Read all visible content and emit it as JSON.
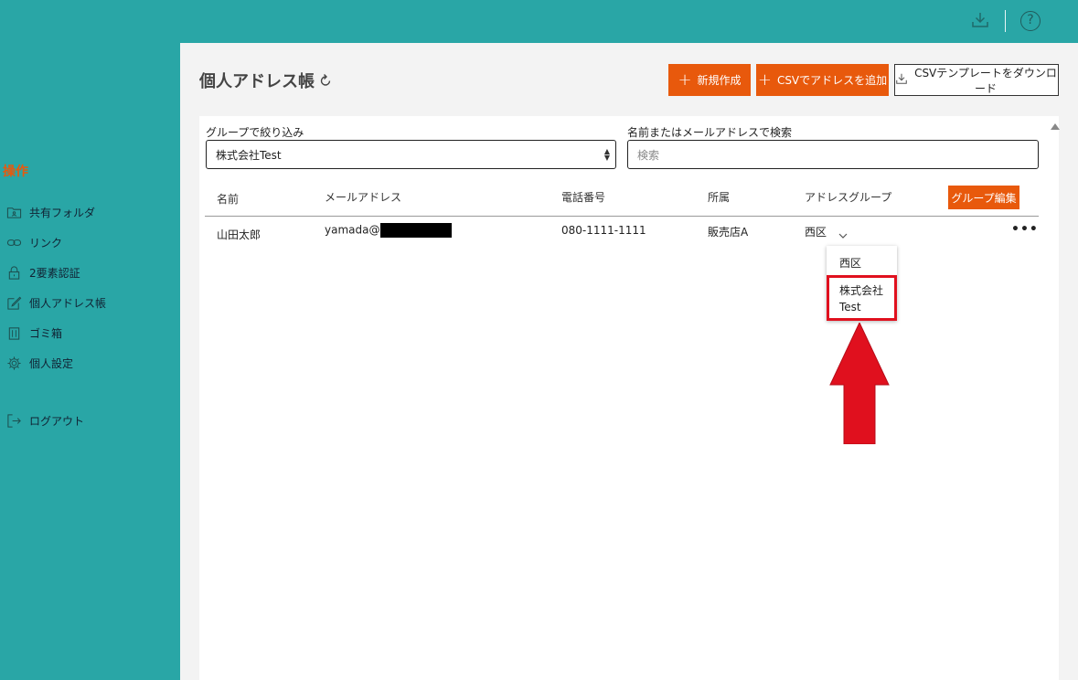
{
  "topbar": {
    "download_icon": "download-icon",
    "help_icon": "help-icon",
    "help_glyph": "?"
  },
  "sidebar": {
    "section_title": "操作",
    "items": [
      {
        "label": "共有フォルダ",
        "icon": "shared-folder-icon"
      },
      {
        "label": "リンク",
        "icon": "link-icon"
      },
      {
        "label": "2要素認証",
        "icon": "lock-icon"
      },
      {
        "label": "個人アドレス帳",
        "icon": "edit-icon"
      },
      {
        "label": "ゴミ箱",
        "icon": "trash-icon"
      },
      {
        "label": "個人設定",
        "icon": "gear-icon"
      },
      {
        "label": "ログアウト",
        "icon": "logout-icon"
      }
    ]
  },
  "header": {
    "title": "個人アドレス帳",
    "new_button": "新規作成",
    "csv_add_button": "CSVでアドレスを追加",
    "csv_template_button": "CSVテンプレートをダウンロード"
  },
  "filter": {
    "group_label": "グループで絞り込み",
    "group_value": "株式会社Test",
    "search_label": "名前またはメールアドレスで検索",
    "search_placeholder": "検索"
  },
  "table": {
    "columns": [
      "名前",
      "メールアドレス",
      "電話番号",
      "所属",
      "アドレスグループ"
    ],
    "group_edit_button": "グループ編集",
    "rows": [
      {
        "name": "山田太郎",
        "email": "yamada@",
        "phone": "080-1111-1111",
        "affiliation": "販売店A",
        "group": "西区"
      }
    ]
  },
  "dropdown": {
    "options": [
      "西区",
      "株式会社",
      "Test"
    ]
  },
  "colors": {
    "teal": "#29a6a6",
    "accent_orange": "#e8590c",
    "annotation_red": "#e0101e"
  }
}
